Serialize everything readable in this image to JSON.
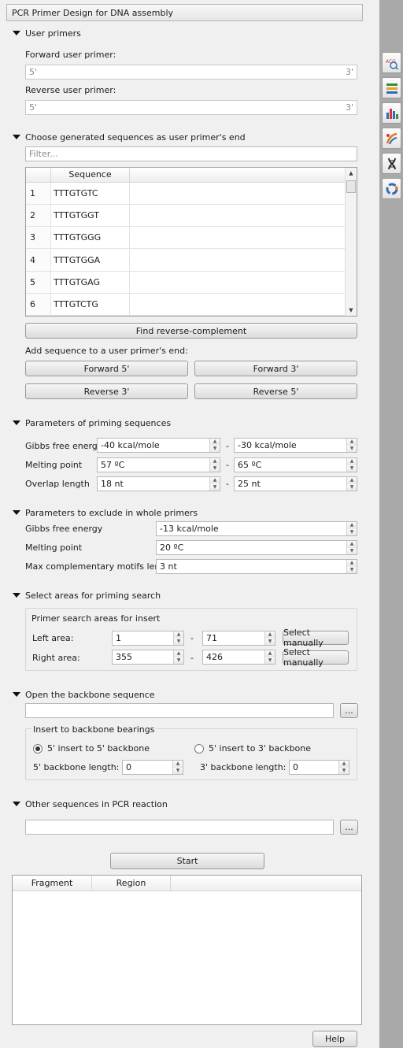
{
  "window": {
    "title": "PCR Primer Design for DNA assembly"
  },
  "user_primers": {
    "header": "User primers",
    "forward_label": "Forward user primer:",
    "reverse_label": "Reverse user primer:",
    "prime5": "5'",
    "prime3": "3'"
  },
  "generated": {
    "header": "Choose generated sequences as user primer's end",
    "filter_placeholder": "Filter...",
    "column_header": "Sequence",
    "rows": [
      {
        "n": "1",
        "seq": "TTTGTGTC"
      },
      {
        "n": "2",
        "seq": "TTTGTGGT"
      },
      {
        "n": "3",
        "seq": "TTTGTGGG"
      },
      {
        "n": "4",
        "seq": "TTTGTGGA"
      },
      {
        "n": "5",
        "seq": "TTTGTGAG"
      },
      {
        "n": "6",
        "seq": "TTTGTCTG"
      }
    ],
    "find_rc": "Find reverse-complement",
    "add_label": "Add sequence to a user primer's end:",
    "fwd5": "Forward 5'",
    "fwd3": "Forward 3'",
    "rev3": "Reverse 3'",
    "rev5": "Reverse 5'"
  },
  "priming": {
    "header": "Parameters of priming sequences",
    "dash": "-",
    "gibbs_label": "Gibbs free energy",
    "gibbs_min": "-40 kcal/mole",
    "gibbs_max": "-30 kcal/mole",
    "melt_label": "Melting point",
    "melt_min": "57 ºC",
    "melt_max": "65 ºC",
    "overlap_label": "Overlap length",
    "overlap_min": "18 nt",
    "overlap_max": "25 nt"
  },
  "exclude": {
    "header": "Parameters to exclude in whole primers",
    "gibbs_label": "Gibbs free energy",
    "gibbs_val": "-13 kcal/mole",
    "melt_label": "Melting point",
    "melt_val": "20 ºC",
    "motif_label": "Max complementary motifs length",
    "motif_val": "3 nt"
  },
  "areas": {
    "header": "Select areas for priming search",
    "group_title": "Primer search areas for insert",
    "left_label": "Left area:",
    "left_from": "1",
    "left_to": "71",
    "right_label": "Right area:",
    "right_from": "355",
    "right_to": "426",
    "select_manually": "Select manually",
    "dash": "-"
  },
  "backbone": {
    "header": "Open the backbone sequence",
    "browse": "...",
    "group_title": "Insert to backbone bearings",
    "opt1": "5' insert to 5' backbone",
    "opt2": "5' insert to 3' backbone",
    "len5_label": "5' backbone length:",
    "len5_val": "0",
    "len3_label": "3' backbone length:",
    "len3_val": "0"
  },
  "other": {
    "header": "Other sequences in PCR reaction",
    "browse": "..."
  },
  "start": "Start",
  "results": {
    "col_fragment": "Fragment",
    "col_region": "Region"
  },
  "help": "Help",
  "sidebar": {
    "icons": [
      "sequence-search-icon",
      "layers-icon",
      "chart-icon",
      "pcr-icon",
      "dna-icon",
      "circular-view-icon"
    ]
  }
}
